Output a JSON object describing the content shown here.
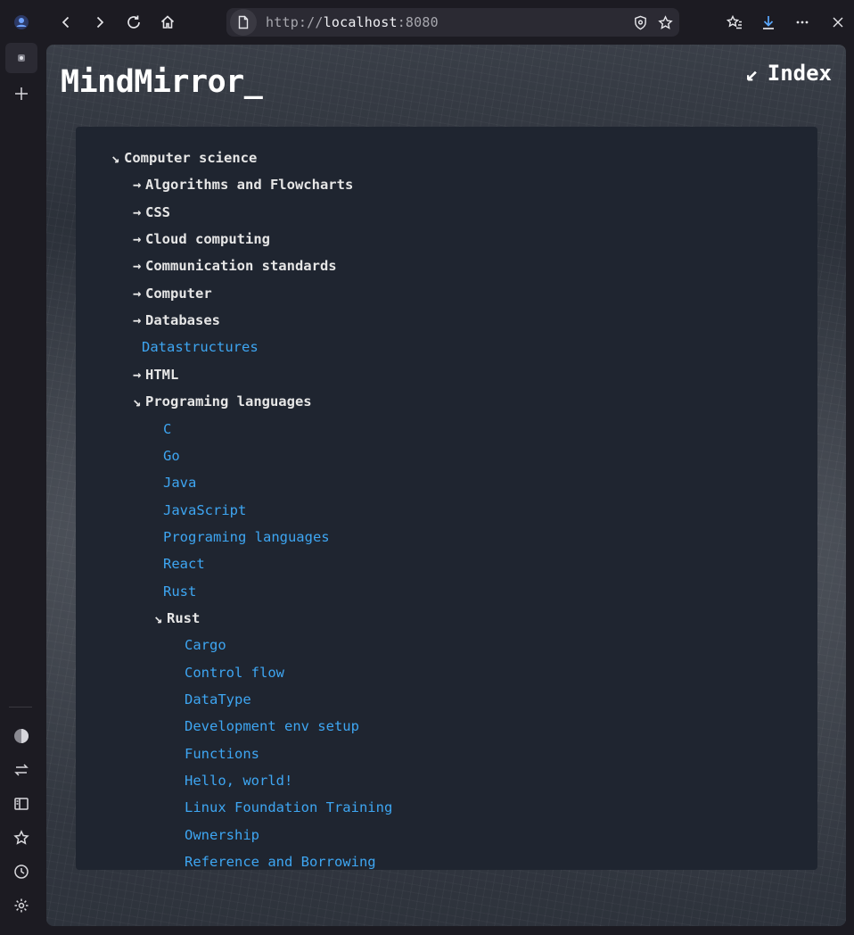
{
  "browser": {
    "url_scheme": "http://",
    "url_host": "localhost",
    "url_port": ":8080"
  },
  "page": {
    "title": "MindMirror_",
    "index_label": "Index",
    "index_arrow": "↙"
  },
  "tree": [
    {
      "label": "Computer science",
      "type": "folder",
      "expanded": true,
      "depth": 0
    },
    {
      "label": "Algorithms and Flowcharts",
      "type": "folder",
      "expanded": false,
      "depth": 1
    },
    {
      "label": "CSS",
      "type": "folder",
      "expanded": false,
      "depth": 1
    },
    {
      "label": "Cloud computing",
      "type": "folder",
      "expanded": false,
      "depth": 1
    },
    {
      "label": "Communication standards",
      "type": "folder",
      "expanded": false,
      "depth": 1
    },
    {
      "label": "Computer",
      "type": "folder",
      "expanded": false,
      "depth": 1
    },
    {
      "label": "Databases",
      "type": "folder",
      "expanded": false,
      "depth": 1
    },
    {
      "label": "Datastructures",
      "type": "link",
      "depth": 1
    },
    {
      "label": "HTML",
      "type": "folder",
      "expanded": false,
      "depth": 1
    },
    {
      "label": "Programing languages",
      "type": "folder",
      "expanded": true,
      "depth": 1
    },
    {
      "label": "C",
      "type": "link",
      "depth": 2
    },
    {
      "label": "Go",
      "type": "link",
      "depth": 2
    },
    {
      "label": "Java",
      "type": "link",
      "depth": 2
    },
    {
      "label": "JavaScript",
      "type": "link",
      "depth": 2
    },
    {
      "label": "Programing languages",
      "type": "link",
      "depth": 2
    },
    {
      "label": "React",
      "type": "link",
      "depth": 2
    },
    {
      "label": "Rust",
      "type": "link",
      "depth": 2
    },
    {
      "label": "Rust",
      "type": "folder",
      "expanded": true,
      "depth": 2
    },
    {
      "label": "Cargo",
      "type": "link",
      "depth": 3
    },
    {
      "label": "Control flow",
      "type": "link",
      "depth": 3
    },
    {
      "label": "DataType",
      "type": "link",
      "depth": 3
    },
    {
      "label": "Development env setup",
      "type": "link",
      "depth": 3
    },
    {
      "label": "Functions",
      "type": "link",
      "depth": 3
    },
    {
      "label": "Hello, world!",
      "type": "link",
      "depth": 3
    },
    {
      "label": "Linux Foundation Training",
      "type": "link",
      "depth": 3
    },
    {
      "label": "Ownership",
      "type": "link",
      "depth": 3
    },
    {
      "label": "Reference and Borrowing",
      "type": "link",
      "depth": 3
    }
  ],
  "colors": {
    "folder_text": "#e6e6e6",
    "link_text": "#3ea6f2",
    "panel_bg": "#1f2530"
  },
  "glyphs": {
    "expanded": "↘",
    "collapsed": "→"
  }
}
